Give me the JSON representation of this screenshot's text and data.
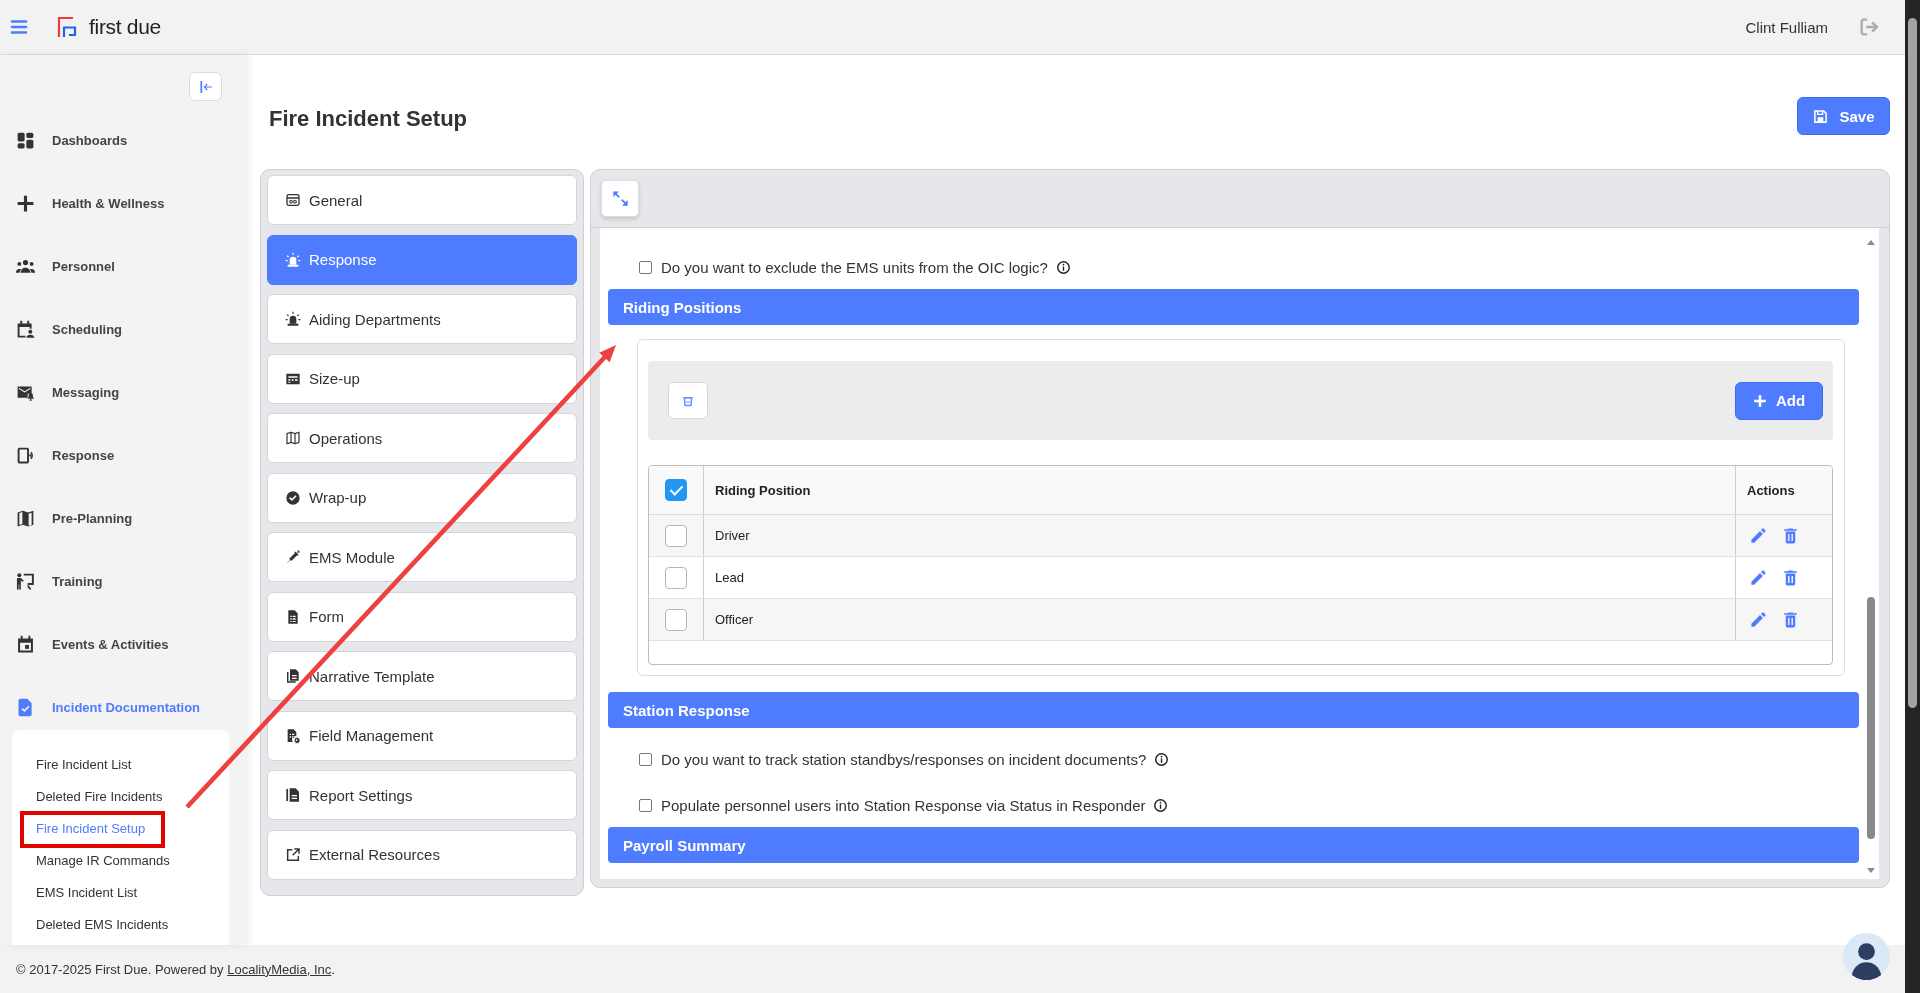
{
  "topbar": {
    "logo_text": "first due",
    "user_name": "Clint Fulliam"
  },
  "sidebar": {
    "items": [
      {
        "label": "Dashboards",
        "selected": false
      },
      {
        "label": "Health & Wellness",
        "selected": false
      },
      {
        "label": "Personnel",
        "selected": false
      },
      {
        "label": "Scheduling",
        "selected": false
      },
      {
        "label": "Messaging",
        "selected": false
      },
      {
        "label": "Response",
        "selected": false
      },
      {
        "label": "Pre-Planning",
        "selected": false
      },
      {
        "label": "Training",
        "selected": false
      },
      {
        "label": "Events & Activities",
        "selected": false
      },
      {
        "label": "Incident Documentation",
        "selected": true,
        "expanded": true,
        "children": [
          {
            "label": "Fire Incident List",
            "selected": false,
            "highlighted": false
          },
          {
            "label": "Deleted Fire Incidents",
            "selected": false,
            "highlighted": false
          },
          {
            "label": "Fire Incident Setup",
            "selected": true,
            "highlighted": true
          },
          {
            "label": "Manage IR Commands",
            "selected": false,
            "highlighted": false
          },
          {
            "label": "EMS Incident List",
            "selected": false,
            "highlighted": false
          },
          {
            "label": "Deleted EMS Incidents",
            "selected": false,
            "highlighted": false
          }
        ]
      }
    ]
  },
  "page": {
    "title": "Fire Incident Setup",
    "save_button": "Save"
  },
  "setup_menu": {
    "items": [
      {
        "label": "General",
        "selected": false
      },
      {
        "label": "Response",
        "selected": true
      },
      {
        "label": "Aiding Departments",
        "selected": false
      },
      {
        "label": "Size-up",
        "selected": false
      },
      {
        "label": "Operations",
        "selected": false
      },
      {
        "label": "Wrap-up",
        "selected": false
      },
      {
        "label": "EMS Module",
        "selected": false
      },
      {
        "label": "Form",
        "selected": false
      },
      {
        "label": "Narrative Template",
        "selected": false
      },
      {
        "label": "Field Management",
        "selected": false
      },
      {
        "label": "Report Settings",
        "selected": false
      },
      {
        "label": "External Resources",
        "selected": false
      }
    ]
  },
  "content": {
    "items": [
      {
        "kind": "option",
        "label": "Do you want to exclude the EMS units from the OIC logic?",
        "checked": false,
        "info": true
      },
      {
        "kind": "header",
        "label": "Riding Positions"
      },
      {
        "kind": "table",
        "add_button": "Add",
        "columns": [
          "Riding Position",
          "Actions"
        ],
        "header_checked": true,
        "rows": [
          {
            "name": "Driver",
            "checked": false
          },
          {
            "name": "Lead",
            "checked": false
          },
          {
            "name": "Officer",
            "checked": false
          }
        ]
      },
      {
        "kind": "header",
        "label": "Station Response"
      },
      {
        "kind": "option",
        "label": "Do you want to track station standbys/responses on incident documents?",
        "checked": false,
        "info": true
      },
      {
        "kind": "option",
        "label": "Populate personnel users into Station Response via Status in Responder",
        "checked": false,
        "info": true
      },
      {
        "kind": "header",
        "label": "Payroll Summary"
      }
    ]
  },
  "footer": {
    "text": "© 2017-2025 First Due. Powered by ",
    "link": "LocalityMedia, Inc",
    "text_end": "."
  },
  "annotation_arrow": true
}
